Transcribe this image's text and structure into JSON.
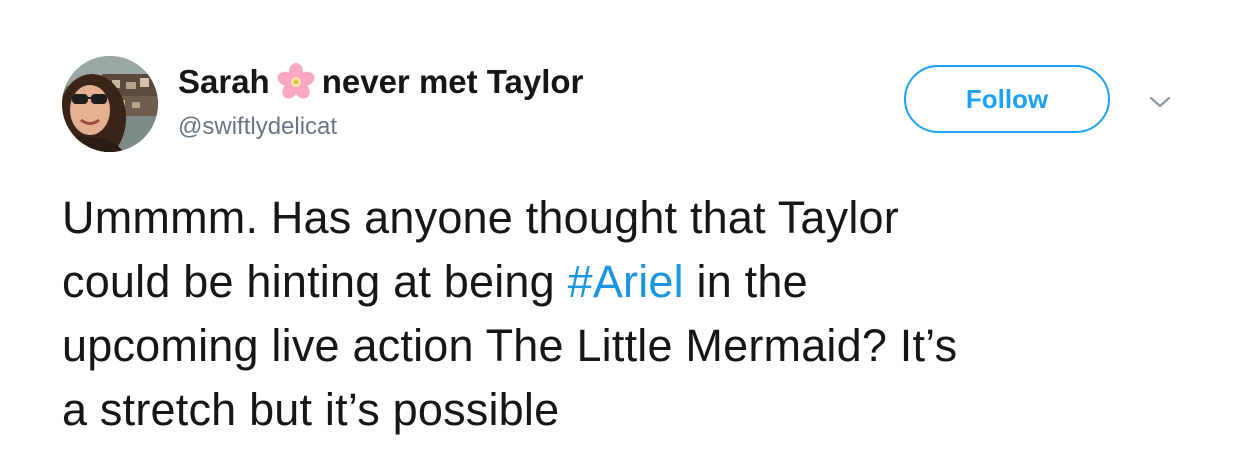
{
  "tweet": {
    "user": {
      "name_first": "Sarah",
      "name_emoji": "cherry-blossom",
      "name_rest": "never met Taylor",
      "handle": "@swiftlydelicat"
    },
    "follow_label": "Follow",
    "menu_icon": "chevron-down-icon",
    "text": {
      "line_1": "Ummmm. Has anyone thought that Taylor",
      "line_2_before": "could be hinting at being ",
      "hashtag": "#Ariel",
      "line_2_after": " in the",
      "line_3": "upcoming live action The Little Mermaid? It’s",
      "line_4": "a stretch but it’s possible"
    }
  },
  "colors": {
    "accent": "#1da1f2",
    "hashtag": "#1b95e0",
    "text": "#14171a",
    "secondary": "#657786"
  }
}
